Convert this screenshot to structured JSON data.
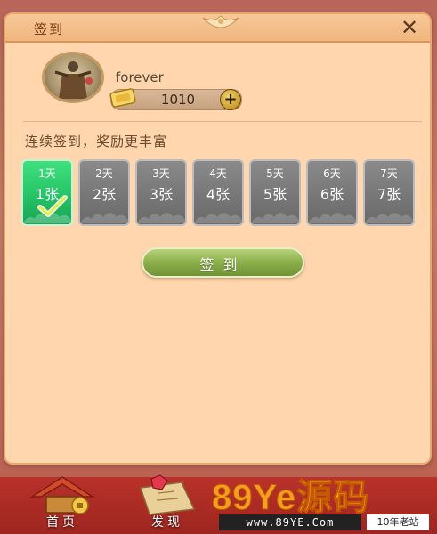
{
  "dialog": {
    "title": "签到",
    "close_symbol": "✕"
  },
  "profile": {
    "username": "forever",
    "coins": "1010",
    "add_symbol": "+",
    "avatar_icon": "character-portrait-icon",
    "coin_icon": "gold-ticket-icon"
  },
  "subtitle": "连续签到，奖励更丰富",
  "days": [
    {
      "day": "1天",
      "reward": "1张",
      "state": "signed"
    },
    {
      "day": "2天",
      "reward": "2张",
      "state": "locked"
    },
    {
      "day": "3天",
      "reward": "3张",
      "state": "locked"
    },
    {
      "day": "4天",
      "reward": "4张",
      "state": "locked"
    },
    {
      "day": "5天",
      "reward": "5张",
      "state": "locked"
    },
    {
      "day": "6天",
      "reward": "6张",
      "state": "locked"
    },
    {
      "day": "7天",
      "reward": "7张",
      "state": "locked"
    }
  ],
  "signin_button": "签到",
  "bottom_nav": [
    {
      "label": "首页",
      "icon": "pagoda-roof-icon"
    },
    {
      "label": "发现",
      "icon": "map-gem-icon"
    }
  ],
  "watermark": {
    "main": "89Ye源码",
    "url": "www.89YE.Com",
    "tag": "10年老站"
  },
  "colors": {
    "dialog_bg": "#ffd6ad",
    "active_day": "#25c466",
    "locked_day": "#777777",
    "button_green": "#8fb24e"
  }
}
